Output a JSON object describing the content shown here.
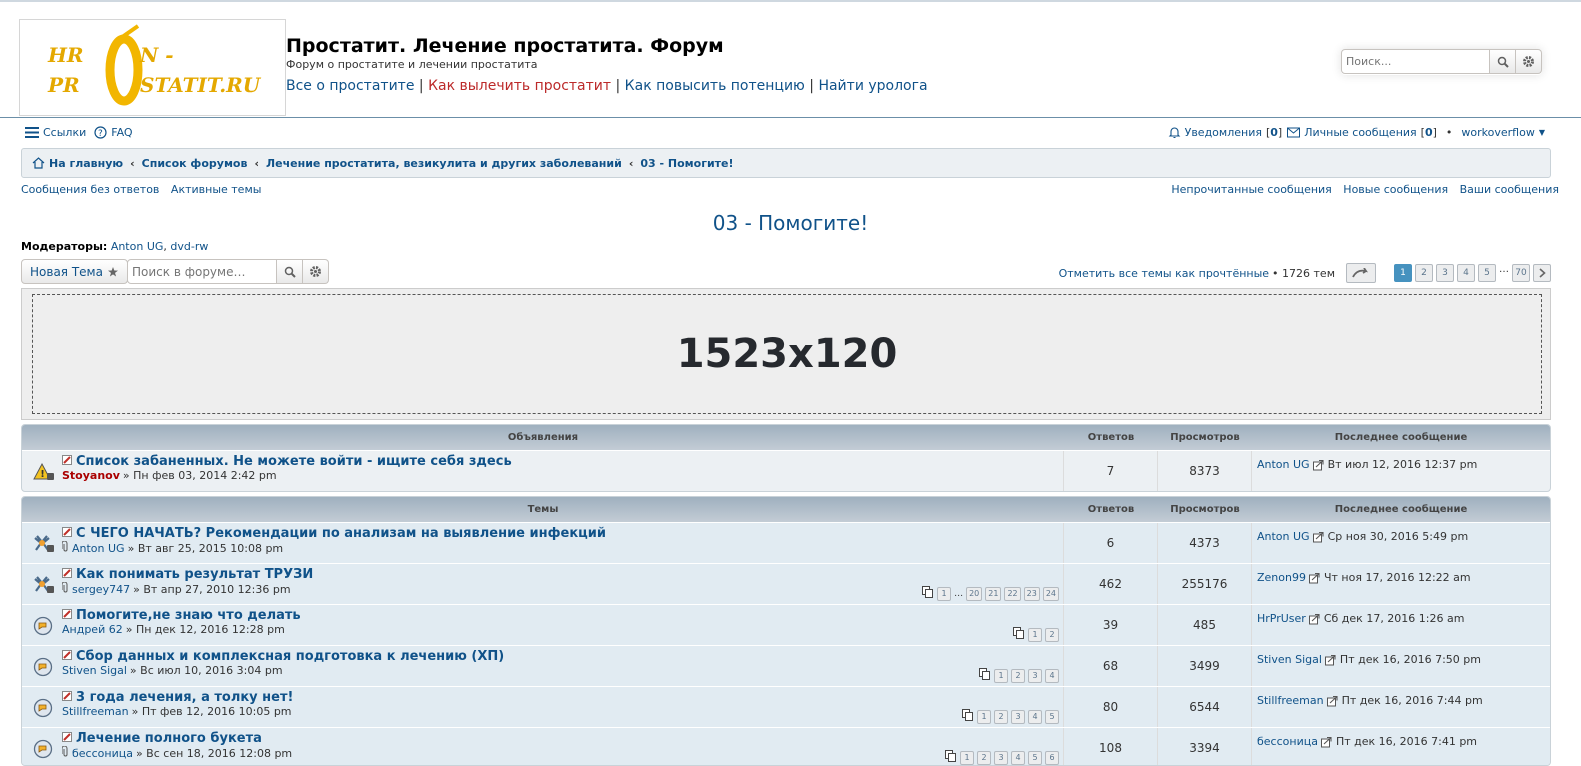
{
  "site": {
    "title": "Простатит. Лечение простатита. Форум",
    "description": "Форум о простатите и лечении простатита",
    "links": [
      "Все о простатите",
      "Как вылечить простатит",
      "Как повысить потенцию",
      "Найти уролога"
    ],
    "separator": "|",
    "logo_text_1": "HR",
    "logo_text_2": "N -",
    "logo_text_3": "PR",
    "logo_text_4": "STATIT.RU"
  },
  "search": {
    "placeholder": "Поиск..."
  },
  "nav": {
    "links_label": "Ссылки",
    "faq_label": "FAQ",
    "notifications_label": "Уведомления",
    "notifications_count": "0",
    "messages_label": "Личные сообщения",
    "messages_count": "0",
    "bullet": "•",
    "user": "workoverflow",
    "user_caret": "▼"
  },
  "breadcrumbs": [
    "На главную",
    "Список форумов",
    "Лечение простатита, везикулита и других заболеваний",
    "03 - Помогите!"
  ],
  "breadcrumb_sep": "‹",
  "quick_left": [
    "Сообщения без ответов",
    "Активные темы"
  ],
  "quick_right": [
    "Непрочитанные сообщения",
    "Новые сообщения",
    "Ваши сообщения"
  ],
  "forum": {
    "title": "03 - Помогите!",
    "moderators_label": "Модераторы:",
    "moderators": [
      "Anton UG",
      "dvd-rw"
    ],
    "moderators_sep": ","
  },
  "actions": {
    "new_topic": "Новая Тема",
    "forum_search_placeholder": "Поиск в форуме…",
    "mark_read": "Отметить все темы как прочтённые",
    "topic_count": "• 1726 тем",
    "pages": [
      "1",
      "2",
      "3",
      "4",
      "5",
      "…",
      "70"
    ],
    "active_page": "1"
  },
  "ad": {
    "text": "1523x120"
  },
  "announcements": {
    "headers": {
      "title": "Объявления",
      "replies": "Ответов",
      "views": "Просмотров",
      "last": "Последнее сообщение"
    },
    "rows": [
      {
        "title": "Список забаненных. Не можете войти - ищите себя здесь",
        "author": "Stoyanov",
        "date": "» Пн фев 03, 2014 2:42 pm",
        "replies": "7",
        "views": "8373",
        "last_author": "Anton UG",
        "last_date": "Вт июл 12, 2016 12:37 pm",
        "pages": []
      }
    ]
  },
  "topics": {
    "headers": {
      "title": "Темы",
      "replies": "Ответов",
      "views": "Просмотров",
      "last": "Последнее сообщение"
    },
    "rows": [
      {
        "title": "С ЧЕГО НАЧАТЬ? Рекомендации по анализам на выявление инфекций",
        "author": "Anton UG",
        "date": "» Вт авг 25, 2015 10:08 pm",
        "replies": "6",
        "views": "4373",
        "last_author": "Anton UG",
        "last_date": "Ср ноя 30, 2016 5:49 pm",
        "pages": [],
        "attach": true,
        "sticky": true
      },
      {
        "title": "Как понимать результат ТРУЗИ",
        "author": "sergey747",
        "date": "» Вт апр 27, 2010 12:36 pm",
        "replies": "462",
        "views": "255176",
        "last_author": "Zenon99",
        "last_date": "Чт ноя 17, 2016 12:22 am",
        "pages": [
          "1",
          "…",
          "20",
          "21",
          "22",
          "23",
          "24"
        ],
        "attach": true,
        "sticky": true
      },
      {
        "title": "Помогите,не знаю что делать",
        "author": "Андрей 62",
        "date": "» Пн дек 12, 2016 12:28 pm",
        "replies": "39",
        "views": "485",
        "last_author": "HrPrUser",
        "last_date": "Сб дек 17, 2016 1:26 am",
        "pages": [
          "1",
          "2"
        ],
        "attach": false,
        "sticky": false
      },
      {
        "title": "Сбор данных и комплексная подготовка к лечению (ХП)",
        "author": "Stiven Sigal",
        "date": "» Вс июл 10, 2016 3:04 pm",
        "replies": "68",
        "views": "3499",
        "last_author": "Stiven Sigal",
        "last_date": "Пт дек 16, 2016 7:50 pm",
        "pages": [
          "1",
          "2",
          "3",
          "4"
        ],
        "attach": false,
        "sticky": false
      },
      {
        "title": "3 года лечения, а толку нет!",
        "author": "Stillfreeman",
        "date": "» Пт фев 12, 2016 10:05 pm",
        "replies": "80",
        "views": "6544",
        "last_author": "Stillfreeman",
        "last_date": "Пт дек 16, 2016 7:44 pm",
        "pages": [
          "1",
          "2",
          "3",
          "4",
          "5"
        ],
        "attach": false,
        "sticky": false
      },
      {
        "title": "Лечение полного букета",
        "author": "бессоница",
        "date": "» Вс сен 18, 2016 12:08 pm",
        "replies": "108",
        "views": "3394",
        "last_author": "бессоница",
        "last_date": "Пт дек 16, 2016 7:41 pm",
        "pages": [
          "1",
          "2",
          "3",
          "4",
          "5",
          "6"
        ],
        "attach": true,
        "sticky": false
      }
    ]
  }
}
